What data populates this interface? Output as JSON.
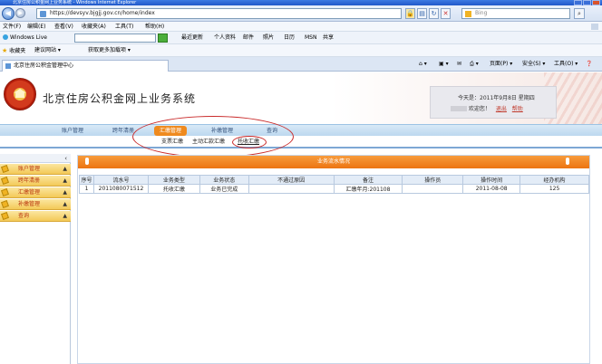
{
  "browser": {
    "title": "北京住房公积金网上业务系统 - Windows Internet Explorer",
    "url": "https://devsyv.bjgjj.gov.cn/home/index",
    "search_placeholder": "Bing",
    "menu": [
      "文件(F)",
      "编辑(E)",
      "查看(V)",
      "收藏夹(A)",
      "工具(T)",
      "帮助(H)"
    ],
    "toolbar_items": [
      "Windows Live",
      "最近更新",
      "个人资料",
      "邮件",
      "照片",
      "日历",
      "MSN",
      "共享"
    ],
    "favorites": [
      "收藏夹",
      "建议网站 ▾",
      "获取更多加载项 ▾"
    ],
    "tab_title": "北京住房公积金管理中心",
    "commands": [
      "页面(P) ▾",
      "安全(S) ▾",
      "工具(O) ▾"
    ]
  },
  "site": {
    "title": "北京住房公积金网上业务系统",
    "today_label": "今天是：2011年9月8日 星期四",
    "welcome_label": "欢迎您！",
    "logout_label": "退出",
    "help_label": "帮助"
  },
  "mainnav": [
    "账户管理",
    "跨年清册",
    "汇缴管理",
    "补缴管理",
    "查询"
  ],
  "subnav": [
    "支票汇缴",
    "主动汇款汇缴",
    "托收汇缴"
  ],
  "sidebar": [
    "账户管理",
    "跨年清册",
    "汇缴管理",
    "补缴管理",
    "查询"
  ],
  "section_title": "业务流水情况",
  "table": {
    "headers": [
      "序号",
      "流水号",
      "业务类型",
      "业务状态",
      "不通过原因",
      "备注",
      "操作员",
      "操作时间",
      "经办机构"
    ],
    "rows": [
      [
        "1",
        "2011080071512",
        "托收汇缴",
        "业务已完成",
        "",
        "汇缴年月:201108",
        "",
        "2011-08-08",
        "125"
      ]
    ]
  },
  "colors": {
    "accent_orange": "#ec7411",
    "annotation_red": "#c92a2a",
    "nav_blue": "#bcd8ef"
  }
}
